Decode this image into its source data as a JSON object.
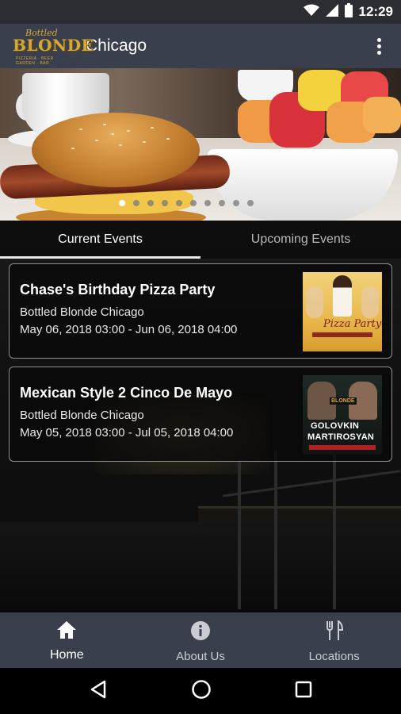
{
  "status_bar": {
    "time": "12:29"
  },
  "app_bar": {
    "logo": {
      "script": "Bottled",
      "wordmark": "BLONDE",
      "tagline": "PIZZERIA · BEER GARDEN · BAR"
    },
    "title": "Chicago",
    "overflow_icon": "more-vert-icon"
  },
  "hero": {
    "carousel": {
      "count": 10,
      "active_index": 0
    }
  },
  "tabs": [
    {
      "label": "Current Events",
      "active": true
    },
    {
      "label": "Upcoming Events",
      "active": false
    }
  ],
  "events": [
    {
      "title": "Chase's Birthday Pizza Party",
      "venue": "Bottled Blonde Chicago",
      "dates": "May 06, 2018 03:00 - Jun 06, 2018 04:00",
      "thumbnail": {
        "headline": "Pizza Party"
      }
    },
    {
      "title": "Mexican Style 2 Cinco De Mayo",
      "venue": "Bottled Blonde Chicago",
      "dates": "May 05, 2018 03:00 - Jul 05, 2018 04:00",
      "thumbnail": {
        "badge": "BLONDE",
        "name1": "GOLOVKIN",
        "name2": "MARTIROSYAN"
      }
    }
  ],
  "bottom_nav": [
    {
      "label": "Home",
      "icon": "home-icon",
      "active": true
    },
    {
      "label": "About Us",
      "icon": "info-icon",
      "active": false
    },
    {
      "label": "Locations",
      "icon": "restaurant-icon",
      "active": false
    }
  ],
  "system_nav": [
    "back-icon",
    "home-circle-icon",
    "recents-icon"
  ],
  "colors": {
    "app_bar": "#3a3f4d",
    "status_bar": "#2b2d33",
    "brand_gold": "#d7a733"
  }
}
